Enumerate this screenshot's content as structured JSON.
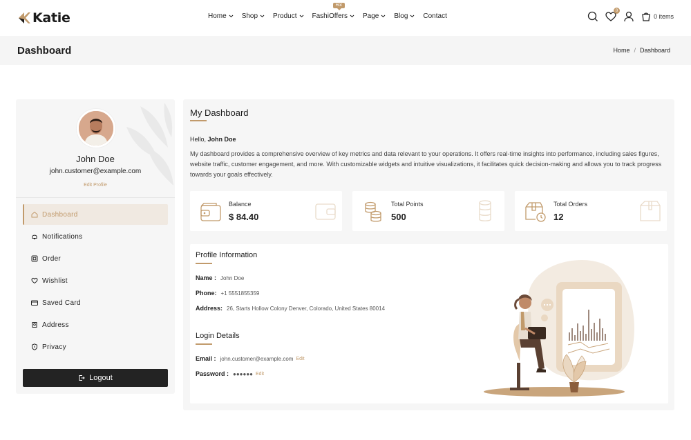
{
  "header": {
    "logo_text": "Katie",
    "nav": [
      {
        "label": "Home",
        "has_dropdown": true
      },
      {
        "label": "Shop",
        "has_dropdown": true
      },
      {
        "label": "Product",
        "has_dropdown": true
      },
      {
        "label": "FashiOffers",
        "has_dropdown": true,
        "badge": "Hot"
      },
      {
        "label": "Page",
        "has_dropdown": true
      },
      {
        "label": "Blog",
        "has_dropdown": true
      },
      {
        "label": "Contact",
        "has_dropdown": false
      }
    ],
    "icons": [
      "search-icon",
      "heart-icon",
      "user-icon",
      "cart-icon"
    ],
    "wishlist_count": "0",
    "cart_text": "0 items"
  },
  "banner": {
    "title": "Dashboard",
    "breadcrumb": [
      "Home",
      "Dashboard"
    ],
    "separator": "/"
  },
  "sidebar": {
    "name": "John Doe",
    "email": "john.customer@example.com",
    "edit_profile": "Edit Profile",
    "menu": [
      {
        "label": "Dashboard",
        "icon": "home-icon",
        "active": true
      },
      {
        "label": "Notifications",
        "icon": "bell-icon",
        "active": false
      },
      {
        "label": "Order",
        "icon": "order-icon",
        "active": false
      },
      {
        "label": "Wishlist",
        "icon": "heart-icon",
        "active": false
      },
      {
        "label": "Saved Card",
        "icon": "card-icon",
        "active": false
      },
      {
        "label": "Address",
        "icon": "address-icon",
        "active": false
      },
      {
        "label": "Privacy",
        "icon": "shield-icon",
        "active": false
      }
    ],
    "logout": "Logout"
  },
  "main": {
    "title": "My Dashboard",
    "hello_prefix": "Hello,",
    "hello_name": "John Doe",
    "description": "My dashboard provides a comprehensive overview of key metrics and data relevant to your operations. It offers real-time insights into performance, including sales figures, website traffic, customer engagement, and more. With customizable widgets and intuitive visualizations, it facilitates quick decision-making and allows you to track progress towards your goals effectively.",
    "stats": [
      {
        "label": "Balance",
        "value": "$ 84.40",
        "icon": "wallet-icon"
      },
      {
        "label": "Total Points",
        "value": "500",
        "icon": "coins-icon"
      },
      {
        "label": "Total Orders",
        "value": "12",
        "icon": "box-clock-icon"
      }
    ],
    "profile_info": {
      "title": "Profile Information",
      "name_label": "Name :",
      "name_value": "John Doe",
      "phone_label": "Phone:",
      "phone_value": "+1 5551855359",
      "address_label": "Address:",
      "address_value": "26, Starts Hollow Colony Denver, Colorado, United States 80014"
    },
    "login_details": {
      "title": "Login Details",
      "email_label": "Email :",
      "email_value": "john.customer@example.com",
      "email_edit": "Edit",
      "password_label": "Password :",
      "password_value": "●●●●●●",
      "password_edit": "Edit"
    }
  },
  "colors": {
    "accent": "#c19a6b",
    "dark": "#232323",
    "panel": "#f6f6f6"
  }
}
